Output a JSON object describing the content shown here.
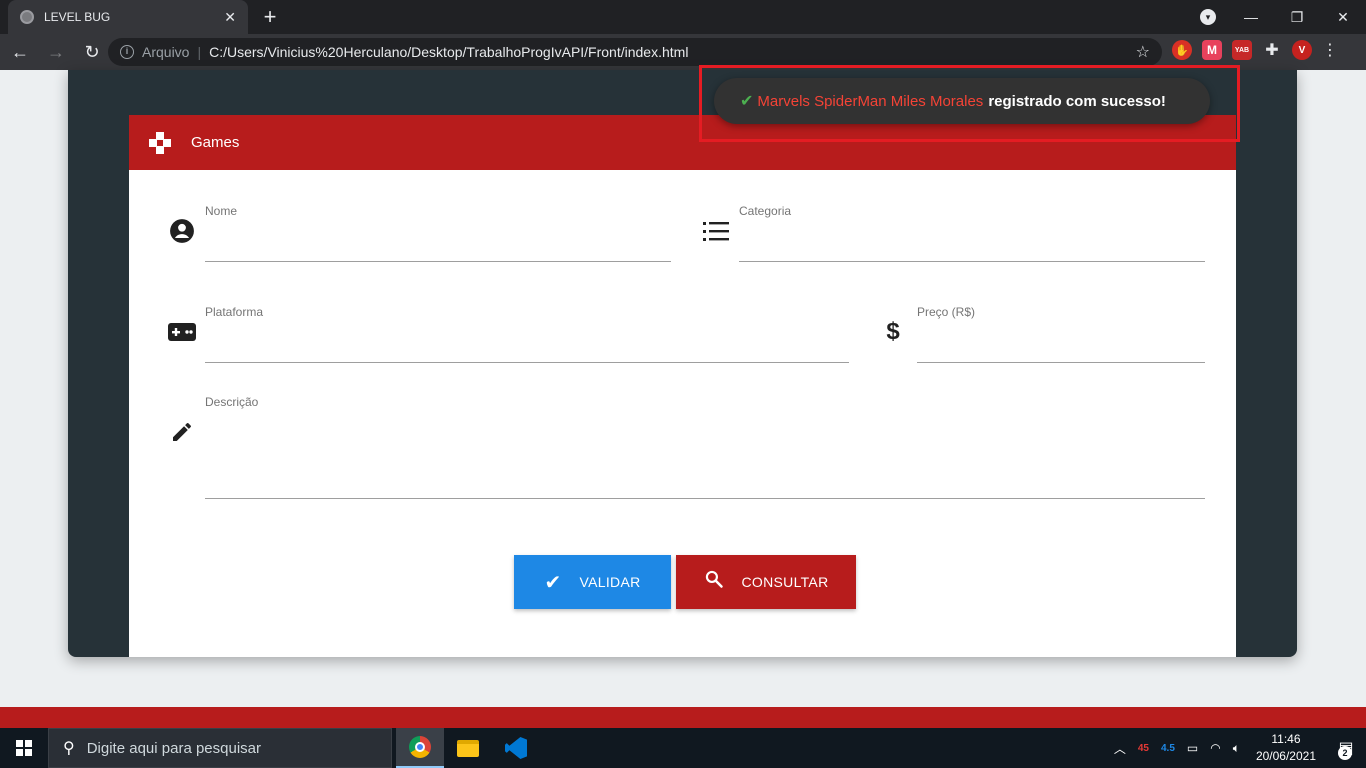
{
  "browser": {
    "tab_title": "LEVEL BUG",
    "tab_close": "✕",
    "new_tab": "+",
    "omnibox_scheme": "Arquivo",
    "omnibox_url": "C:/Users/Vinicius%20Herculano/Desktop/TrabalhoProgIvAPI/Front/index.html",
    "profile_initial": "V",
    "ext_m": "M",
    "ext_yab": "YAB"
  },
  "form": {
    "header_title": "Games",
    "fields": {
      "nome": {
        "label": "Nome",
        "value": ""
      },
      "categoria": {
        "label": "Categoria",
        "value": ""
      },
      "plataforma": {
        "label": "Plataforma",
        "value": ""
      },
      "preco": {
        "label": "Preço (R$)",
        "value": ""
      },
      "descricao": {
        "label": "Descrição",
        "value": ""
      }
    },
    "buttons": {
      "validar": "VALIDAR",
      "consultar": "CONSULTAR"
    }
  },
  "toast": {
    "game_name": "Marvels SpiderMan Miles Morales",
    "message": "registrado com sucesso!"
  },
  "taskbar": {
    "search_placeholder": "Digite aqui para pesquisar",
    "tray_val_red": "45",
    "tray_val_blue": "4.5",
    "time": "11:46",
    "date": "20/06/2021",
    "notifications": "2"
  },
  "colors": {
    "accent_red": "#b71c1c",
    "accent_blue": "#1e88e5",
    "dark_panel": "#263238",
    "toast_bg": "#323232"
  }
}
